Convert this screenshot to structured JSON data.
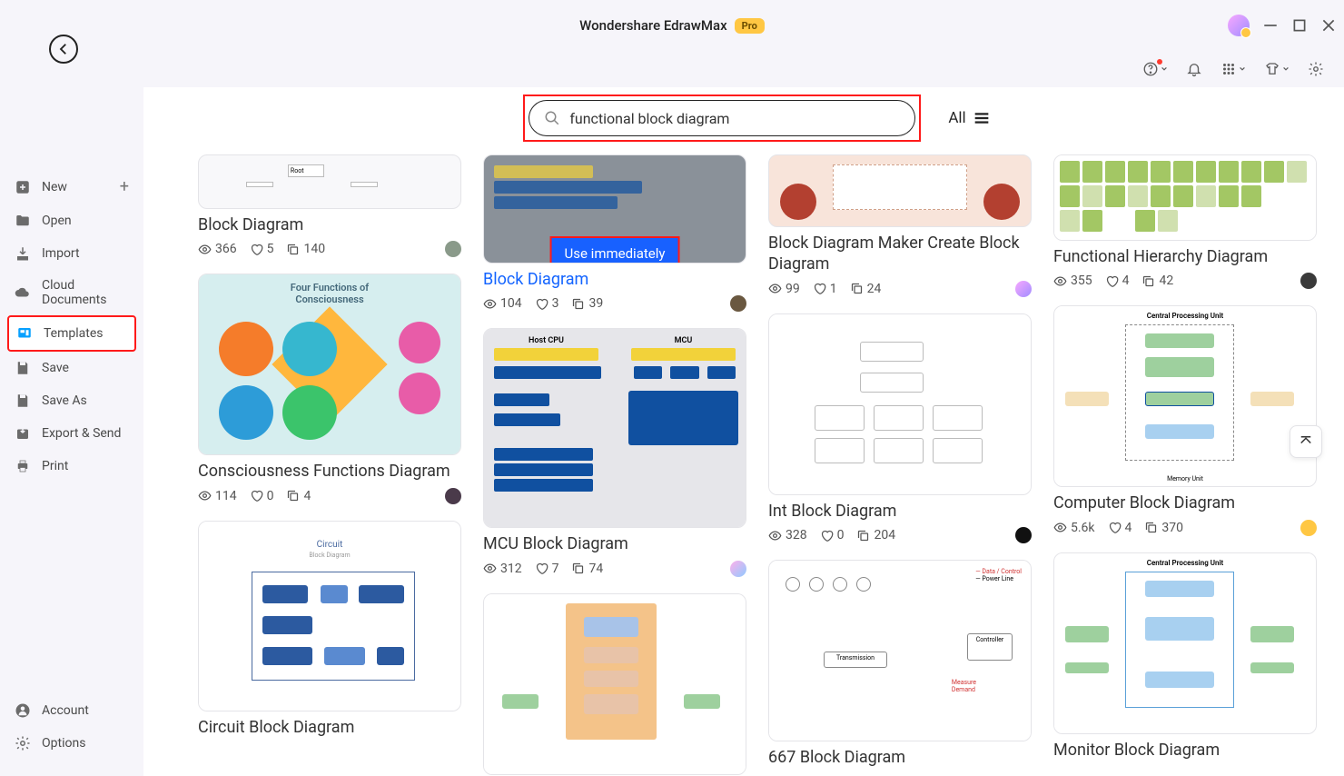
{
  "app": {
    "title": "Wondershare EdrawMax",
    "badge": "Pro"
  },
  "sidebar": {
    "items": [
      {
        "label": "New",
        "has_plus": true
      },
      {
        "label": "Open"
      },
      {
        "label": "Import"
      },
      {
        "label": "Cloud Documents"
      },
      {
        "label": "Templates",
        "selected": true
      },
      {
        "label": "Save"
      },
      {
        "label": "Save As"
      },
      {
        "label": "Export & Send"
      },
      {
        "label": "Print"
      }
    ],
    "footer": [
      {
        "label": "Account"
      },
      {
        "label": "Options"
      }
    ]
  },
  "search": {
    "value": "functional block diagram",
    "filter_label": "All"
  },
  "cards": {
    "c0": {
      "title": "Block Diagram",
      "views": "366",
      "likes": "5",
      "copies": "140",
      "avatar": "#8a9a8a"
    },
    "c1": {
      "title": "Block Diagram",
      "use_btn": "Use immediately",
      "views": "104",
      "likes": "3",
      "copies": "39",
      "avatar": "#6a5840"
    },
    "c2": {
      "title": "Block Diagram Maker Create Block Diagram",
      "views": "99",
      "likes": "1",
      "copies": "24",
      "avatar": "linear-gradient(135deg,#f8a8ff,#a18dff)"
    },
    "c3": {
      "title": "Functional Hierarchy Diagram",
      "views": "355",
      "likes": "4",
      "copies": "42",
      "avatar": "#3a3a3a"
    },
    "c4": {
      "title": "Consciousness Functions Diagram",
      "views": "114",
      "likes": "0",
      "copies": "4",
      "avatar": "#4a3a4a"
    },
    "c5": {
      "title": "MCU Block Diagram",
      "views": "312",
      "likes": "7",
      "copies": "74",
      "avatar": "linear-gradient(135deg,#ffb0ea,#8fc9ff)"
    },
    "c6": {
      "title": "Int Block Diagram",
      "views": "328",
      "likes": "0",
      "copies": "204",
      "avatar": "#111"
    },
    "c7": {
      "title": "Computer Block Diagram",
      "views": "5.6k",
      "likes": "4",
      "copies": "370",
      "avatar": "#ffc743"
    },
    "c8": {
      "title": "Circuit Block Diagram"
    },
    "c9": {
      "title": "667 Block Diagram"
    },
    "c10": {
      "title": "Monitor Block Diagram"
    }
  }
}
